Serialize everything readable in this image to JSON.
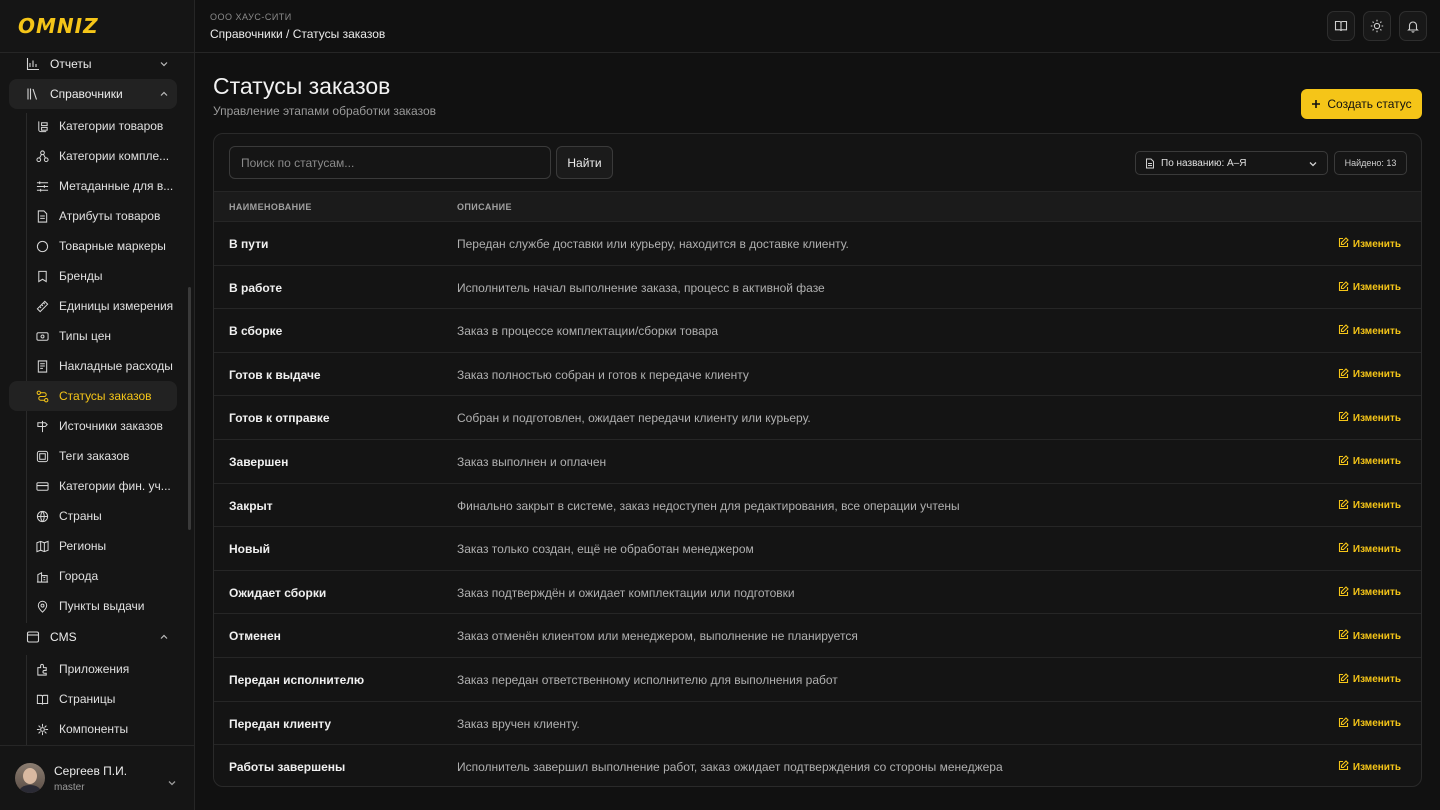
{
  "app": {
    "logo": "OMNIZ",
    "org": "ООО ХАУС-СИТИ",
    "breadcrumb": "Справочники / Статусы заказов"
  },
  "sidebar": {
    "groups": [
      {
        "label": "Отчеты",
        "icon": "chart-icon",
        "expanded": false
      },
      {
        "label": "Справочники",
        "icon": "books-icon",
        "expanded": true
      },
      {
        "label": "CMS",
        "icon": "window-icon",
        "expanded": true
      }
    ],
    "items": [
      {
        "label": "Категории товаров",
        "icon": "categories-icon"
      },
      {
        "label": "Категории компле...",
        "icon": "kit-icon"
      },
      {
        "label": "Метаданные для в...",
        "icon": "sliders-icon"
      },
      {
        "label": "Атрибуты товаров",
        "icon": "document-icon"
      },
      {
        "label": "Товарные маркеры",
        "icon": "circle-icon"
      },
      {
        "label": "Бренды",
        "icon": "bookmark-icon"
      },
      {
        "label": "Единицы измерения",
        "icon": "ruler-icon"
      },
      {
        "label": "Типы цен",
        "icon": "price-icon"
      },
      {
        "label": "Накладные расходы",
        "icon": "invoice-icon"
      },
      {
        "label": "Статусы заказов",
        "icon": "route-icon",
        "active": true
      },
      {
        "label": "Источники заказов",
        "icon": "signpost-icon"
      },
      {
        "label": "Теги заказов",
        "icon": "tag-icon"
      },
      {
        "label": "Категории фин. уч...",
        "icon": "card-icon"
      },
      {
        "label": "Страны",
        "icon": "globe-icon"
      },
      {
        "label": "Регионы",
        "icon": "map-icon"
      },
      {
        "label": "Города",
        "icon": "city-icon"
      },
      {
        "label": "Пункты выдачи",
        "icon": "pin-icon"
      }
    ],
    "cms_items": [
      {
        "label": "Приложения",
        "icon": "puzzle-icon"
      },
      {
        "label": "Страницы",
        "icon": "book-icon"
      },
      {
        "label": "Компоненты",
        "icon": "components-icon"
      }
    ],
    "user": {
      "name": "Сергеев П.И.",
      "role": "master"
    }
  },
  "page": {
    "title": "Статусы заказов",
    "subtitle": "Управление этапами обработки заказов",
    "create_label": "Создать статус",
    "search_placeholder": "Поиск по статусам...",
    "find_label": "Найти",
    "sort_label": "По названию: А–Я",
    "found_label": "Найдено: 13",
    "col_name": "НАИМЕНОВАНИЕ",
    "col_desc": "ОПИСАНИЕ",
    "edit_label": "Изменить"
  },
  "statuses": [
    {
      "name": "В пути",
      "desc": "Передан службе доставки или курьеру, находится в доставке клиенту."
    },
    {
      "name": "В работе",
      "desc": "Исполнитель начал выполнение заказа, процесс в активной фазе"
    },
    {
      "name": "В сборке",
      "desc": "Заказ в процессе комплектации/сборки товара"
    },
    {
      "name": "Готов к выдаче",
      "desc": "Заказ полностью собран и готов к передаче клиенту"
    },
    {
      "name": "Готов к отправке",
      "desc": "Собран и подготовлен, ожидает передачи клиенту или курьеру."
    },
    {
      "name": "Завершен",
      "desc": "Заказ выполнен и оплачен"
    },
    {
      "name": "Закрыт",
      "desc": "Финально закрыт в системе, заказ недоступен для редактирования, все операции учтены"
    },
    {
      "name": "Новый",
      "desc": "Заказ только создан, ещё не обработан менеджером"
    },
    {
      "name": "Ожидает сборки",
      "desc": "Заказ подтверждён и ожидает комплектации или подготовки"
    },
    {
      "name": "Отменен",
      "desc": "Заказ отменён клиентом или менеджером, выполнение не планируется"
    },
    {
      "name": "Передан исполнителю",
      "desc": "Заказ передан ответственному исполнителю для выполнения работ"
    },
    {
      "name": "Передан клиенту",
      "desc": "Заказ вручен клиенту."
    },
    {
      "name": "Работы завершены",
      "desc": "Исполнитель завершил выполнение работ, заказ ожидает подтверждения со стороны менеджера"
    }
  ],
  "colors": {
    "accent": "#f5c518",
    "bg": "#111111",
    "surface": "#141414"
  }
}
